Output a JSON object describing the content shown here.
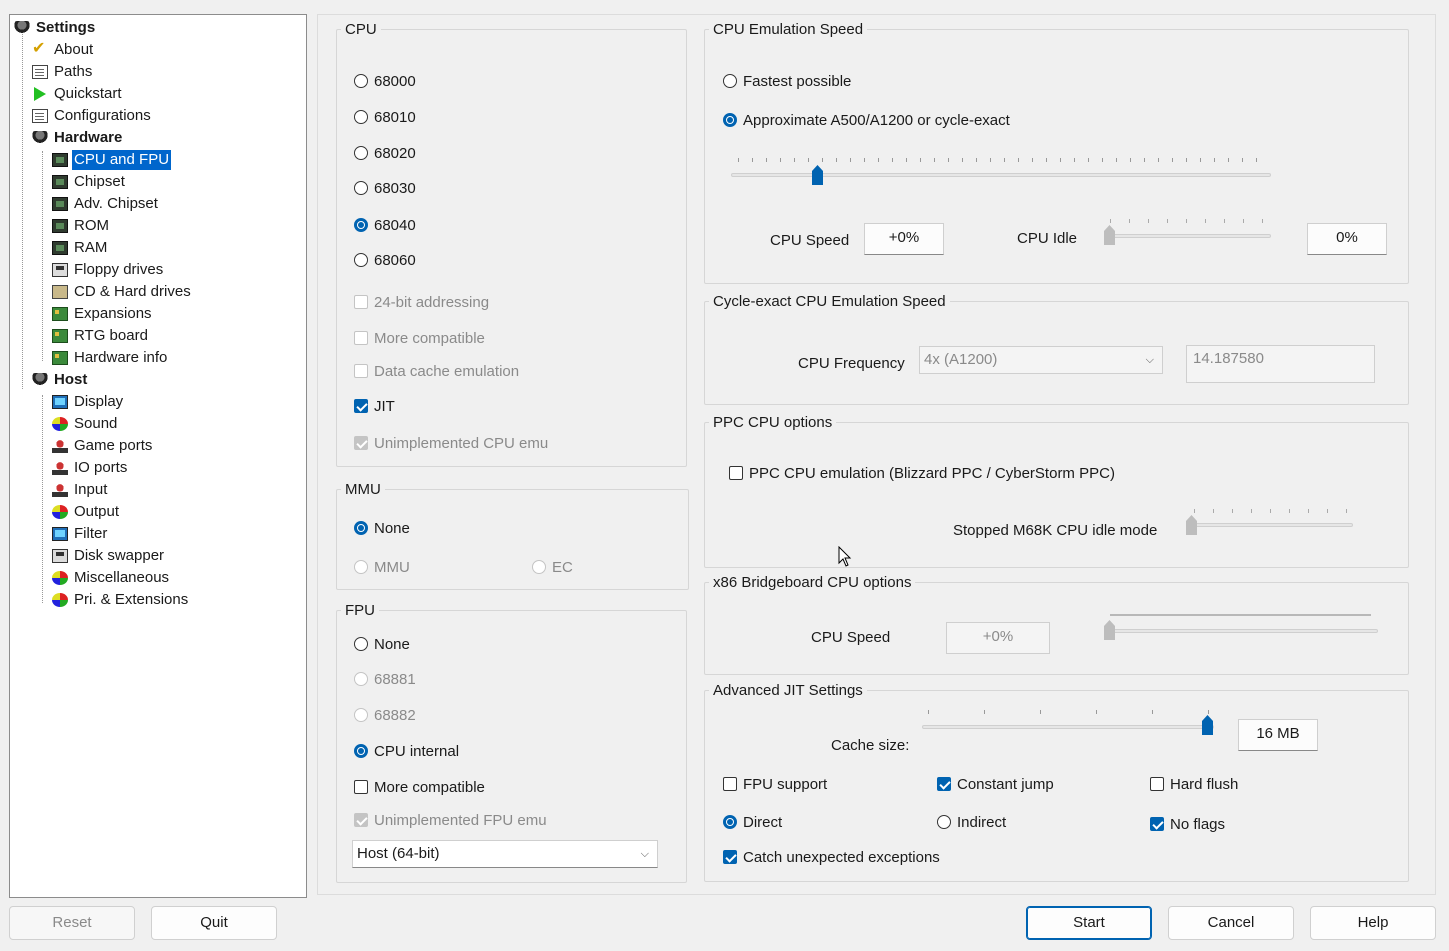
{
  "tree": {
    "settings": "Settings",
    "about": "About",
    "paths": "Paths",
    "quickstart": "Quickstart",
    "configurations": "Configurations",
    "hardware": "Hardware",
    "cpu_fpu": "CPU and FPU",
    "chipset": "Chipset",
    "adv_chipset": "Adv. Chipset",
    "rom": "ROM",
    "ram": "RAM",
    "floppy": "Floppy drives",
    "cd_hd": "CD & Hard drives",
    "expansions": "Expansions",
    "rtg": "RTG board",
    "hwinfo": "Hardware info",
    "host": "Host",
    "display": "Display",
    "sound": "Sound",
    "gameports": "Game ports",
    "ioports": "IO ports",
    "input": "Input",
    "output": "Output",
    "filter": "Filter",
    "diskswapper": "Disk swapper",
    "misc": "Miscellaneous",
    "pri_ext": "Pri. & Extensions"
  },
  "cpu": {
    "title": "CPU",
    "models": [
      "68000",
      "68010",
      "68020",
      "68030",
      "68040",
      "68060"
    ],
    "selected": "68040",
    "addr24": "24-bit addressing",
    "more_compatible": "More compatible",
    "data_cache": "Data cache emulation",
    "jit": "JIT",
    "unimpl": "Unimplemented CPU emu"
  },
  "mmu": {
    "title": "MMU",
    "none": "None",
    "mmu": "MMU",
    "ec": "EC"
  },
  "fpu": {
    "title": "FPU",
    "none": "None",
    "f68881": "68881",
    "f68882": "68882",
    "internal": "CPU internal",
    "more_compatible": "More compatible",
    "unimpl": "Unimplemented FPU emu",
    "mode": "Host (64-bit)"
  },
  "emu_speed": {
    "title": "CPU Emulation Speed",
    "fastest": "Fastest possible",
    "approx": "Approximate A500/A1200 or cycle-exact",
    "cpu_speed_label": "CPU Speed",
    "cpu_speed_value": "+0%",
    "cpu_idle_label": "CPU Idle",
    "cpu_idle_value": "0%"
  },
  "cycle_exact": {
    "title": "Cycle-exact CPU Emulation Speed",
    "freq_label": "CPU Frequency",
    "freq_select": "4x (A1200)",
    "freq_value": "14.187580"
  },
  "ppc": {
    "title": "PPC CPU options",
    "emulation": "PPC CPU emulation (Blizzard PPC / CyberStorm PPC)",
    "idle_label": "Stopped M68K CPU idle mode"
  },
  "x86": {
    "title": "x86 Bridgeboard CPU options",
    "speed_label": "CPU Speed",
    "speed_value": "+0%"
  },
  "jit": {
    "title": "Advanced JIT Settings",
    "cache_label": "Cache size:",
    "cache_value": "16 MB",
    "fpu_support": "FPU support",
    "constant_jump": "Constant jump",
    "hard_flush": "Hard flush",
    "direct": "Direct",
    "indirect": "Indirect",
    "no_flags": "No flags",
    "catch": "Catch unexpected exceptions"
  },
  "buttons": {
    "reset": "Reset",
    "quit": "Quit",
    "start": "Start",
    "cancel": "Cancel",
    "help": "Help"
  },
  "colors": {
    "accent": "#0063b1",
    "selection": "#0066cc"
  }
}
